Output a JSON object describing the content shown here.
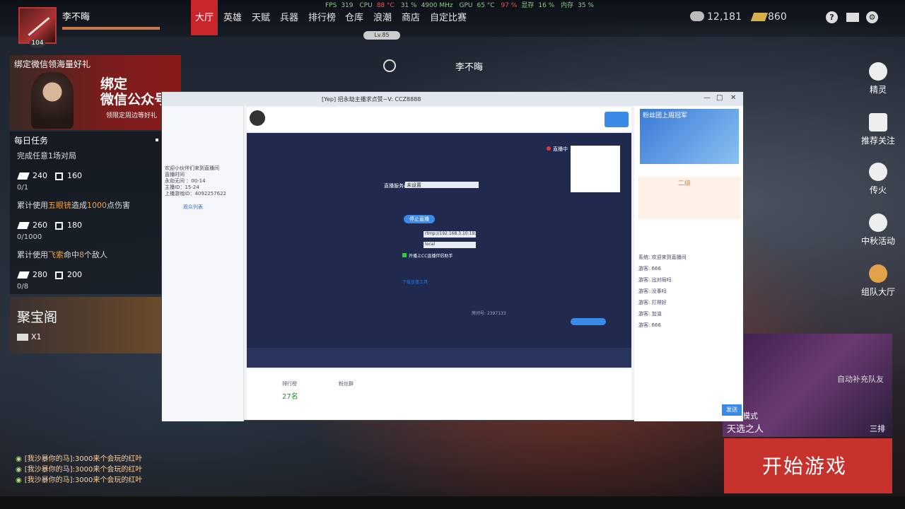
{
  "player": {
    "name": "李不晦",
    "level": "104",
    "lv_badge": "Lv.85"
  },
  "nav": [
    "大厅",
    "英雄",
    "天赋",
    "兵器",
    "排行榜",
    "仓库",
    "浪潮",
    "商店",
    "自定比赛"
  ],
  "sysinfo": {
    "fps_label": "FPS",
    "fps": "319",
    "cpu_label": "CPU",
    "cpu_temp": "88 °C",
    "cpu_load": "31 %",
    "cpu_freq": "4900 MHz",
    "gpu_label": "GPU",
    "gpu_temp": "65 °C",
    "gpu_load": "97 %",
    "vram_label": "显存",
    "vram": "16 %",
    "ram_label": "内存",
    "ram": "35 %"
  },
  "currency": {
    "coins": "12,181",
    "gold": "860"
  },
  "center_name": "李不晦",
  "promo": {
    "title": "绑定微信领海量好礼",
    "big1": "绑定",
    "big2": "微信公众号",
    "small": "领限定周边等好礼"
  },
  "tasks": {
    "title": "每日任务",
    "items": [
      {
        "text": "完成任意1场对局",
        "r1": "240",
        "r2": "160",
        "progress": "0/1"
      },
      {
        "text_pre": "累计使用",
        "highlight": "五眼铳",
        "text_mid": "造成",
        "highlight2": "1000",
        "text_post": "点伤害",
        "r1": "260",
        "r2": "180",
        "progress": "0/1000"
      },
      {
        "text_pre": "累计使用",
        "highlight": "飞索",
        "text_mid": "命中",
        "highlight2": "8",
        "text_post": "个敌人",
        "r1": "280",
        "r2": "200",
        "progress": "0/8"
      }
    ]
  },
  "jubao": {
    "title": "聚宝阁",
    "count": "X1"
  },
  "chatlog": [
    "[我沙暴你的马]:3000来个会玩的红叶",
    "[我沙暴你的马]:3000来个会玩的红叶",
    "[我沙暴你的马]:3000来个会玩的红叶"
  ],
  "right_menu": [
    "精灵",
    "推荐关注",
    "传火",
    "中秋活动",
    "组队大厅"
  ],
  "team_card": {
    "label": "自动补充队友",
    "mode": "单排模式",
    "hero": "天选之人",
    "type": "三排"
  },
  "start_button": "开始游戏",
  "stream": {
    "title": "[Yep] 招永劫主播求点赞~V: CCZ8888",
    "live_status": "直播中",
    "server_label": "直播服务器:",
    "server_value": "未设置",
    "start_btn": "停止直播",
    "rtmp_label": "rtmp://192.168.3.10:1935",
    "local_label": "local",
    "check_label": "开播上CC直播伴侣助手",
    "download_link": "下载直播工具",
    "id_label": "房间号",
    "id_value": "2397133",
    "left_info": [
      "欢迎小伙伴们来到直播间",
      "直播时间",
      "永劫无间 ：00-14",
      "主播ID：15-24",
      "上播游戏ID：4092257622"
    ],
    "left_list_title": "观众列表",
    "rank_label": "排行榜",
    "rank_value": "27名",
    "gift_label": "粉丝群",
    "right_banner": "粉丝团上周冠军",
    "right_level": "二级",
    "chat": [
      "系统: 欢迎来到直播间",
      "游客: 666",
      "游客: 出对局吗",
      "游客: 没事吗",
      "游客: 打得好",
      "游客: 加油",
      "游客: 666"
    ],
    "send_btn": "发送"
  }
}
